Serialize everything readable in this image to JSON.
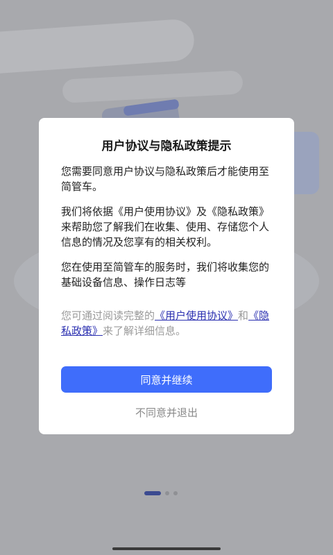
{
  "dialog": {
    "title": "用户协议与隐私政策提示",
    "paragraphs": [
      "您需要同意用户协议与隐私政策后才能使用至简管车。",
      "我们将依据《用户使用协议》及《隐私政策》来帮助您了解我们在收集、使用、存储您个人信息的情况及您享有的相关权利。",
      "您在使用至简管车的服务时，我们将收集您的基础设备信息、操作日志等"
    ],
    "notice_prefix": "您可通过阅读完整的",
    "user_agreement_link": "《用户使用协议》",
    "notice_and": "和",
    "privacy_policy_link": "《隐私政策》",
    "notice_suffix": "来了解详细信息。",
    "agree_label": "同意并继续",
    "disagree_label": "不同意并退出"
  },
  "pager": {
    "total": 3,
    "active_index": 0
  }
}
